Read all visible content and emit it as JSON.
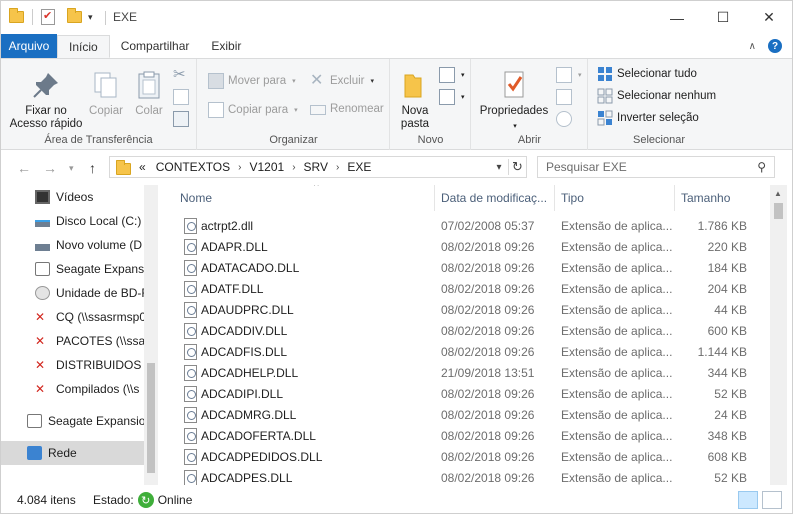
{
  "window": {
    "title": "EXE",
    "controls": {
      "minimize": "—",
      "maximize": "☐",
      "close": "✕"
    }
  },
  "ribbon_tabs": [
    {
      "label": "Arquivo"
    },
    {
      "label": "Início"
    },
    {
      "label": "Compartilhar"
    },
    {
      "label": "Exibir"
    }
  ],
  "ribbon": {
    "clipboard": {
      "label": "Área de Transferência",
      "pin": "Fixar no Acesso rápido",
      "copy": "Copiar",
      "paste": "Colar"
    },
    "organize": {
      "label": "Organizar",
      "move_to": "Mover para",
      "copy_to": "Copiar para",
      "delete": "Excluir",
      "rename": "Renomear"
    },
    "new": {
      "label": "Novo",
      "new_folder": "Nova pasta"
    },
    "open": {
      "label": "Abrir",
      "properties": "Propriedades"
    },
    "select": {
      "label": "Selecionar",
      "select_all": "Selecionar tudo",
      "select_none": "Selecionar nenhum",
      "invert": "Inverter seleção"
    }
  },
  "address": {
    "overflow": "«",
    "crumbs": [
      "CONTEXTOS",
      "V1201",
      "SRV",
      "EXE"
    ],
    "search_placeholder": "Pesquisar EXE"
  },
  "nav_items": [
    {
      "label": "Vídeos",
      "icon": "video-icon"
    },
    {
      "label": "Disco Local (C:)",
      "icon": "drive-icon"
    },
    {
      "label": "Novo volume (D",
      "icon": "drive-icon"
    },
    {
      "label": "Seagate Expansio",
      "icon": "external-drive-icon"
    },
    {
      "label": "Unidade de BD-R",
      "icon": "disc-icon"
    },
    {
      "label": "CQ (\\\\ssasrmsp0",
      "icon": "disconnected-drive-icon"
    },
    {
      "label": "PACOTES (\\\\ssas",
      "icon": "disconnected-drive-icon"
    },
    {
      "label": "DISTRIBUIDOS (\\",
      "icon": "disconnected-drive-icon"
    },
    {
      "label": "Compilados (\\\\s",
      "icon": "disconnected-drive-icon"
    },
    {
      "label": "Seagate Expansion",
      "icon": "external-drive-icon"
    },
    {
      "label": "Rede",
      "icon": "network-icon"
    }
  ],
  "columns": {
    "name": "Nome",
    "modified": "Data de modificaç...",
    "type": "Tipo",
    "size": "Tamanho"
  },
  "files": [
    {
      "name": "actrpt2.dll",
      "modified": "07/02/2008 05:37",
      "type": "Extensão de aplica...",
      "size": "1.786 KB"
    },
    {
      "name": "ADAPR.DLL",
      "modified": "08/02/2018 09:26",
      "type": "Extensão de aplica...",
      "size": "220 KB"
    },
    {
      "name": "ADATACADO.DLL",
      "modified": "08/02/2018 09:26",
      "type": "Extensão de aplica...",
      "size": "184 KB"
    },
    {
      "name": "ADATF.DLL",
      "modified": "08/02/2018 09:26",
      "type": "Extensão de aplica...",
      "size": "204 KB"
    },
    {
      "name": "ADAUDPRC.DLL",
      "modified": "08/02/2018 09:26",
      "type": "Extensão de aplica...",
      "size": "44 KB"
    },
    {
      "name": "ADCADDIV.DLL",
      "modified": "08/02/2018 09:26",
      "type": "Extensão de aplica...",
      "size": "600 KB"
    },
    {
      "name": "ADCADFIS.DLL",
      "modified": "08/02/2018 09:26",
      "type": "Extensão de aplica...",
      "size": "1.144 KB"
    },
    {
      "name": "ADCADHELP.DLL",
      "modified": "21/09/2018 13:51",
      "type": "Extensão de aplica...",
      "size": "344 KB"
    },
    {
      "name": "ADCADIPI.DLL",
      "modified": "08/02/2018 09:26",
      "type": "Extensão de aplica...",
      "size": "52 KB"
    },
    {
      "name": "ADCADMRG.DLL",
      "modified": "08/02/2018 09:26",
      "type": "Extensão de aplica...",
      "size": "24 KB"
    },
    {
      "name": "ADCADOFERTA.DLL",
      "modified": "08/02/2018 09:26",
      "type": "Extensão de aplica...",
      "size": "348 KB"
    },
    {
      "name": "ADCADPEDIDOS.DLL",
      "modified": "08/02/2018 09:26",
      "type": "Extensão de aplica...",
      "size": "608 KB"
    },
    {
      "name": "ADCADPES.DLL",
      "modified": "08/02/2018 09:26",
      "type": "Extensão de aplica...",
      "size": "52 KB"
    }
  ],
  "status": {
    "count": "4.084 itens",
    "state_label": "Estado:",
    "state_value": "Online"
  },
  "colors": {
    "accent": "#1a6fc2",
    "folder": "#f6c44a",
    "online": "#3fae3a"
  }
}
